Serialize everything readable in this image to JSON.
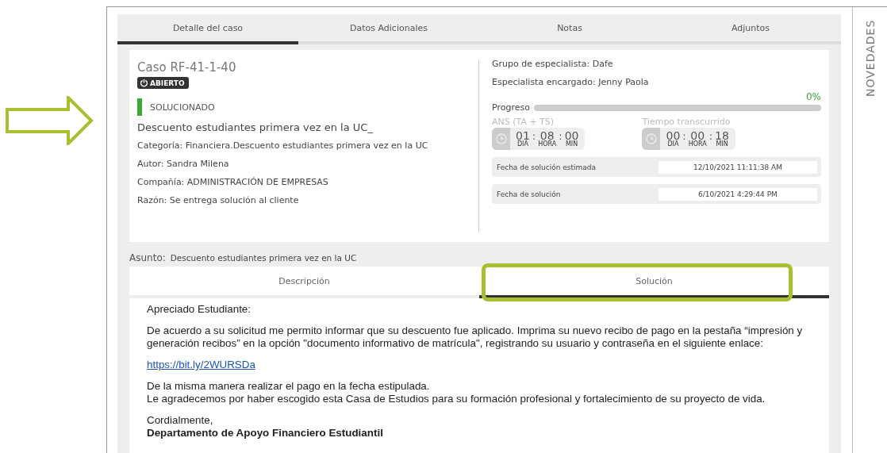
{
  "tabs": [
    {
      "label": "Detalle del caso",
      "selected": true
    },
    {
      "label": "Datos Adicionales",
      "selected": false
    },
    {
      "label": "Notas",
      "selected": false
    },
    {
      "label": "Adjuntos",
      "selected": false
    }
  ],
  "case": {
    "title": "Caso RF-41-1-40",
    "badge": "ABIERTO",
    "status": {
      "label": "SOLUCIONADO",
      "color": "#3aaa35"
    },
    "subject": "Descuento estudiantes primera vez en la UC_",
    "fields": [
      "Categoría: Financiera.Descuento estudiantes primera vez en la UC",
      "Autor: Sandra Milena",
      "Compañía: ADMINISTRACIÓN DE EMPRESAS",
      "Razón: Se entrega solución al cliente"
    ]
  },
  "details": {
    "fields": [
      "Grupo de especialista: Dafe",
      "Especialista encargado: Jenny Paola"
    ],
    "progress": {
      "label": "Progreso",
      "reading": "0%",
      "level": 0
    },
    "timers": [
      {
        "title": "ANS (TA + TS)",
        "separator": ":",
        "parts": [
          {
            "value": "01",
            "unit": "DIA"
          },
          {
            "value": "08",
            "unit": "HORA"
          },
          {
            "value": "00",
            "unit": "MIN"
          }
        ]
      },
      {
        "title": "Tiempo transcurrido",
        "separator": ":",
        "parts": [
          {
            "value": "00",
            "unit": "DIA"
          },
          {
            "value": "00",
            "unit": "HORA"
          },
          {
            "value": "18",
            "unit": "MIN"
          }
        ]
      }
    ],
    "dates": [
      {
        "label": "Fecha de solución estimada",
        "value": "12/10/2021 11:11:38 AM"
      },
      {
        "label": "Fecha de solución",
        "value": "6/10/2021 4:29:44 PM"
      }
    ]
  },
  "asunto": {
    "label": "Asunto:",
    "value": "Descuento estudiantes primera vez en la UC"
  },
  "content_tabs": [
    {
      "label": "Descripción",
      "selected": false
    },
    {
      "label": "Solución",
      "selected": true
    }
  ],
  "message": {
    "greeting": "Apreciado Estudiante:",
    "body": "De acuerdo a su solicitud me permito informar que su descuento fue aplicado. Imprima su nuevo recibo de pago en la pestaña “impresión y generación recibos” en la opción \"documento informativo de matrícula\", registrando su usuario y contraseña en el siguiente enlace:",
    "link": "https://bit.ly/2WURSDa",
    "lines": [
      "De la misma manera realizar el pago en la fecha estipulada.",
      "Le agradecemos por haber escogido esta Casa de Estudios para su formación profesional y fortalecimiento de su proyecto de vida."
    ],
    "closing": "Cordialmente,",
    "signature": "Departamento de Apoyo Financiero Estudiantil"
  },
  "sidebar": {
    "label": "NOVEDADES"
  }
}
